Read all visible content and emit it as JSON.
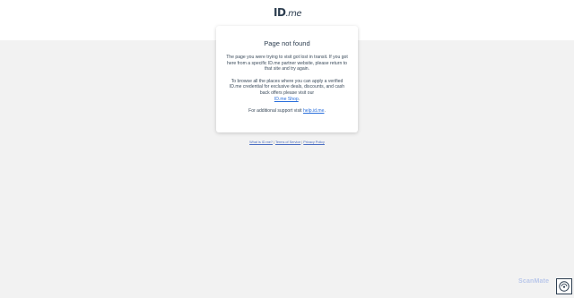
{
  "header": {
    "logo_id": "ID",
    "logo_me": ".me"
  },
  "card": {
    "title": "Page not found",
    "p1": "The page you were trying to visit got lost in transit. If you got here from a specific ID.me partner website, please return to that site and try again.",
    "p2_prefix": "To browse all the places where you can apply a verified ID.me credential for exclusive deals, discounts, and cash back offers please visit our",
    "p2_link": "ID.me Shop",
    "p2_suffix": ".",
    "p3_prefix": "For additional support visit",
    "p3_link": "help.id.me",
    "p3_suffix": "."
  },
  "footer": {
    "links": [
      "What is ID.me?",
      "Terms of Service",
      "Privacy Policy"
    ],
    "separator": "|"
  },
  "watermark": {
    "brand": "ScanMate"
  },
  "icons": {
    "badge": "scanmate-logo-icon"
  }
}
